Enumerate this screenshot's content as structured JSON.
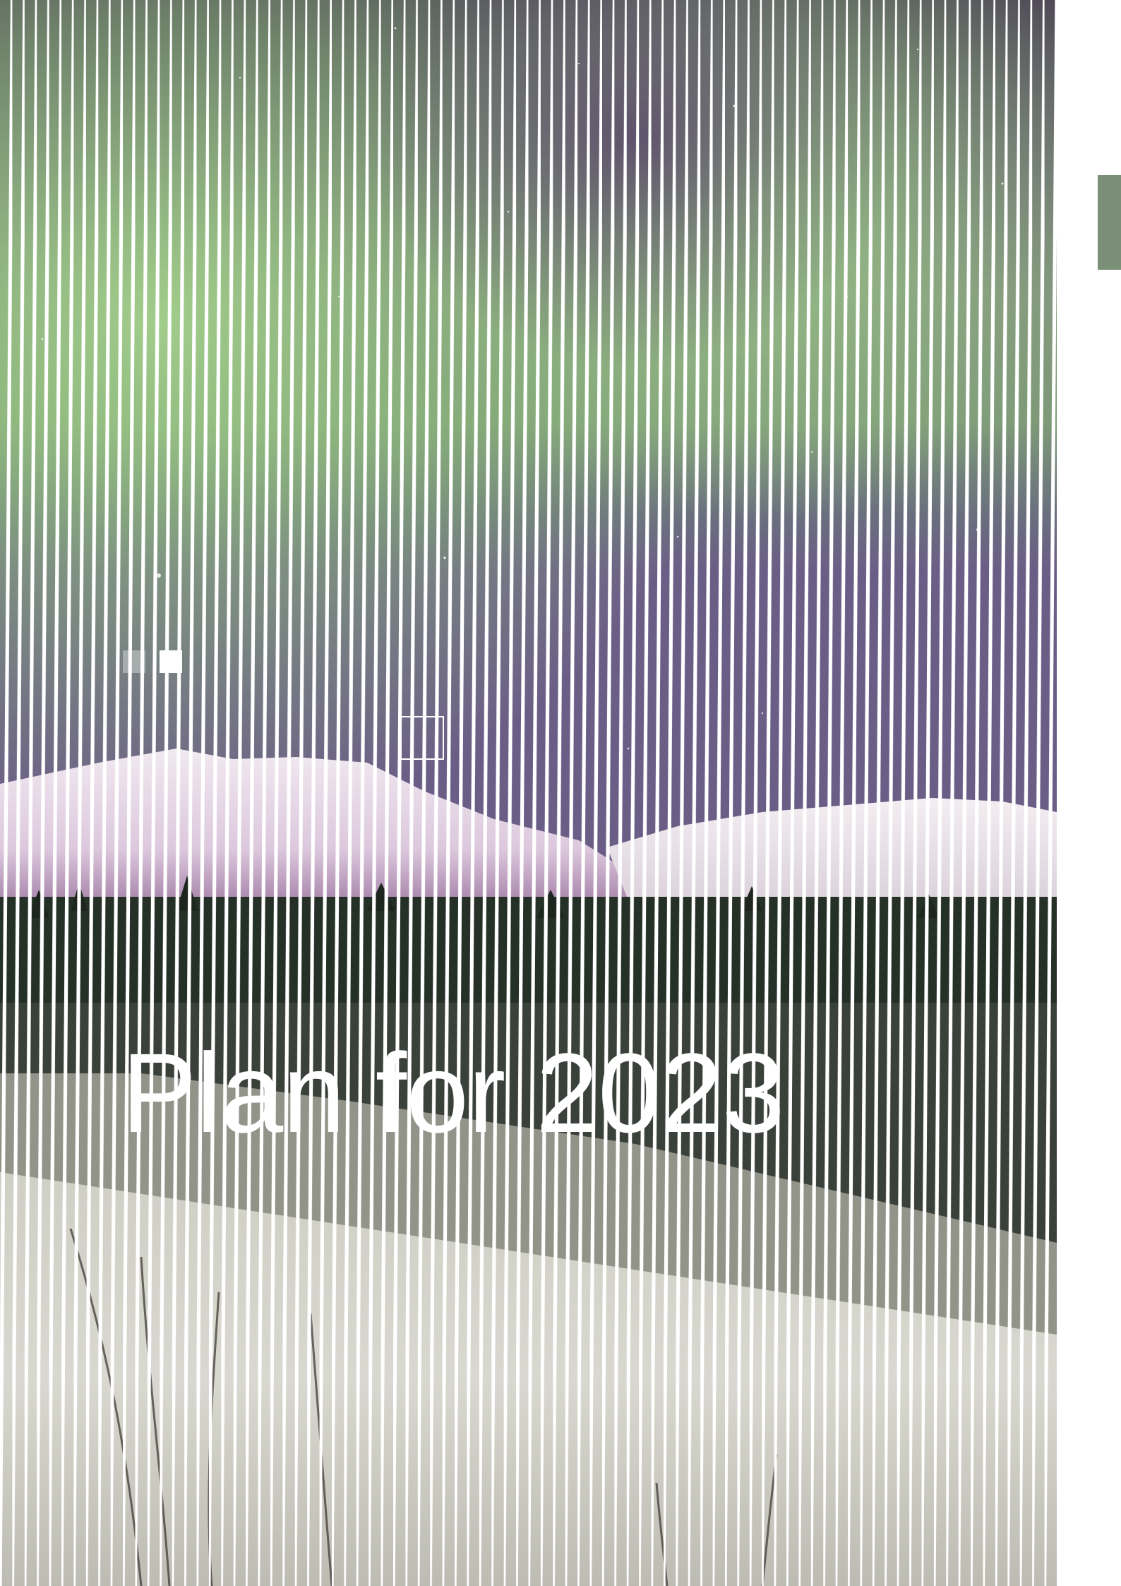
{
  "cover": {
    "title": "Plan for 2023"
  },
  "colors": {
    "side_tab": "#7a8e78",
    "title_text": "#ffffff",
    "page_background": "#ffffff"
  },
  "icons": {
    "hatch_line": "diagonal-hatch-rule",
    "small_squares": "decorative-squares",
    "outline_square": "outline-square"
  }
}
